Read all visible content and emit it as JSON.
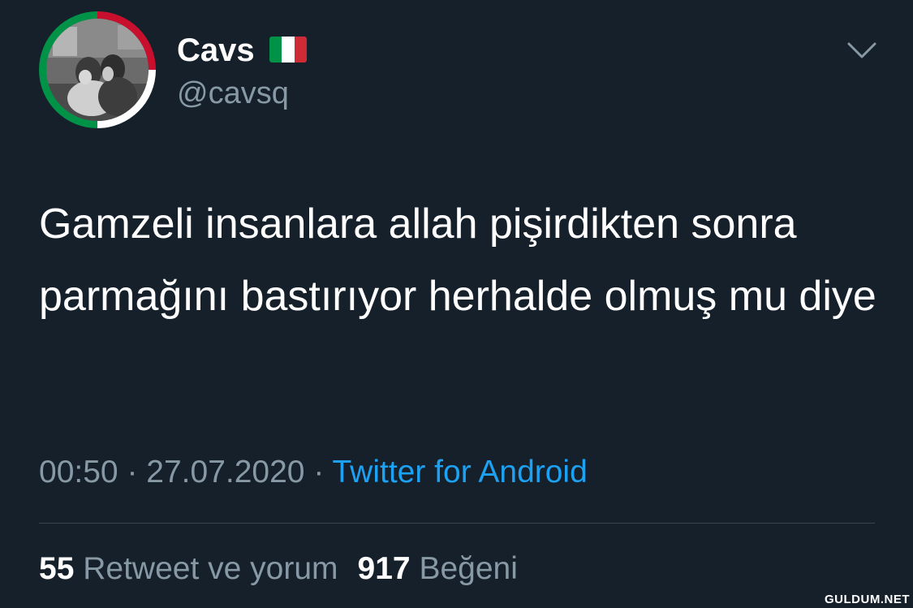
{
  "tweet": {
    "display_name": "Cavs",
    "handle": "@cavsq",
    "text": "Gamzeli insanlara allah pişirdikten sonra parmağını bastırıyor herhalde olmuş mu diye",
    "time": "00:50",
    "date": "27.07.2020",
    "separator": "·",
    "source": "Twitter for Android",
    "retweets_count": "55",
    "retweets_label": "Retweet ve yorum",
    "likes_count": "917",
    "likes_label": "Beğeni"
  },
  "icons": {
    "flag": "italy-flag-icon",
    "menu": "chevron-down-icon"
  },
  "colors": {
    "background": "#15202b",
    "text_primary": "#ffffff",
    "text_secondary": "#8899a6",
    "link": "#1da1f2",
    "divider": "#38444d",
    "avatar_ring": [
      "#c8102e",
      "#ffffff",
      "#009246"
    ]
  },
  "watermark": "GULDUM.NET"
}
